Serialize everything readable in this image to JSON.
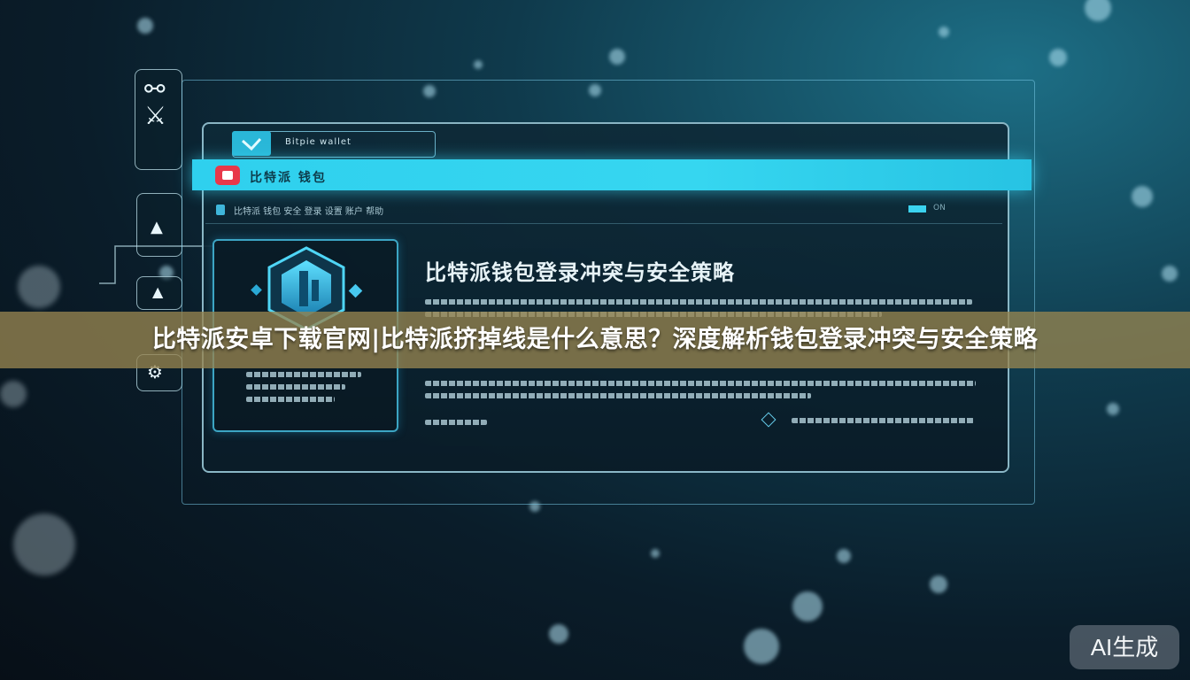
{
  "window": {
    "title": "Bitpie wallet",
    "menu_bar_label": "比特派 钱包",
    "nav_path": "比特派 钱包 安全 登录 设置 账户 帮助",
    "nav_badge": "ON"
  },
  "main": {
    "headline": "比特派钱包登录冲突与安全策略"
  },
  "caption": "比特派安卓下载官网|比特派挤掉线是什么意思？深度解析钱包登录冲突与安全策略",
  "watermark": "AI生成",
  "colors": {
    "accent_cyan": "#2fd0ee",
    "badge_red": "#e8384a",
    "caption_band": "#96844f"
  },
  "icons": [
    "check-icon",
    "wallet-icon",
    "diamond-icon",
    "lock-icon"
  ]
}
